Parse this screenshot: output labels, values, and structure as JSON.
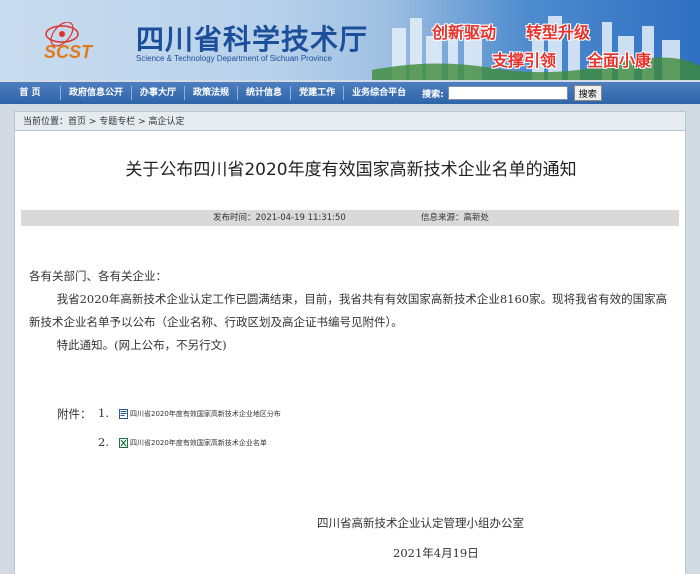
{
  "header": {
    "logo_text": "SCST",
    "site_title": "四川省科学技术厅",
    "site_subtitle": "Science & Technology Department of Sichuan Province",
    "slogans": [
      "创新驱动",
      "转型升级",
      "支撑引领",
      "全面小康"
    ]
  },
  "nav": {
    "items": [
      "首 页",
      "政府信息公开",
      "办事大厅",
      "政策法规",
      "统计信息",
      "党建工作",
      "业务综合平台"
    ],
    "search_label": "搜索:",
    "search_value": "",
    "search_button": "搜索"
  },
  "breadcrumb": {
    "label": "当前位置：",
    "path": "首页 > 专题专栏 > 高企认定"
  },
  "article": {
    "title": "关于公布四川省2020年度有效国家高新技术企业名单的通知",
    "publish_time": "发布时间：2021-04-19 11:31:50",
    "source": "信息来源：高新处",
    "salutation": "各有关部门、各有关企业：",
    "paragraph1": "我省2020年高新技术企业认定工作已圆满结束，目前，我省共有有效国家高新技术企业8160家。现将我省有效的国家高新技术企业名单予以公布（企业名称、行政区划及高企证书编号见附件）。",
    "paragraph2": "特此通知。(网上公布，不另行文)",
    "attachments_label": "附件：",
    "attachments": [
      {
        "num": "1.",
        "name": "四川省2020年度有效国家高新技术企业地区分布",
        "icon": "word-doc-icon"
      },
      {
        "num": "2.",
        "name": "四川省2020年度有效国家高新技术企业名单",
        "icon": "excel-sheet-icon"
      }
    ],
    "signature": "四川省高新技术企业认定管理小组办公室",
    "date": "2021年4月19日"
  }
}
